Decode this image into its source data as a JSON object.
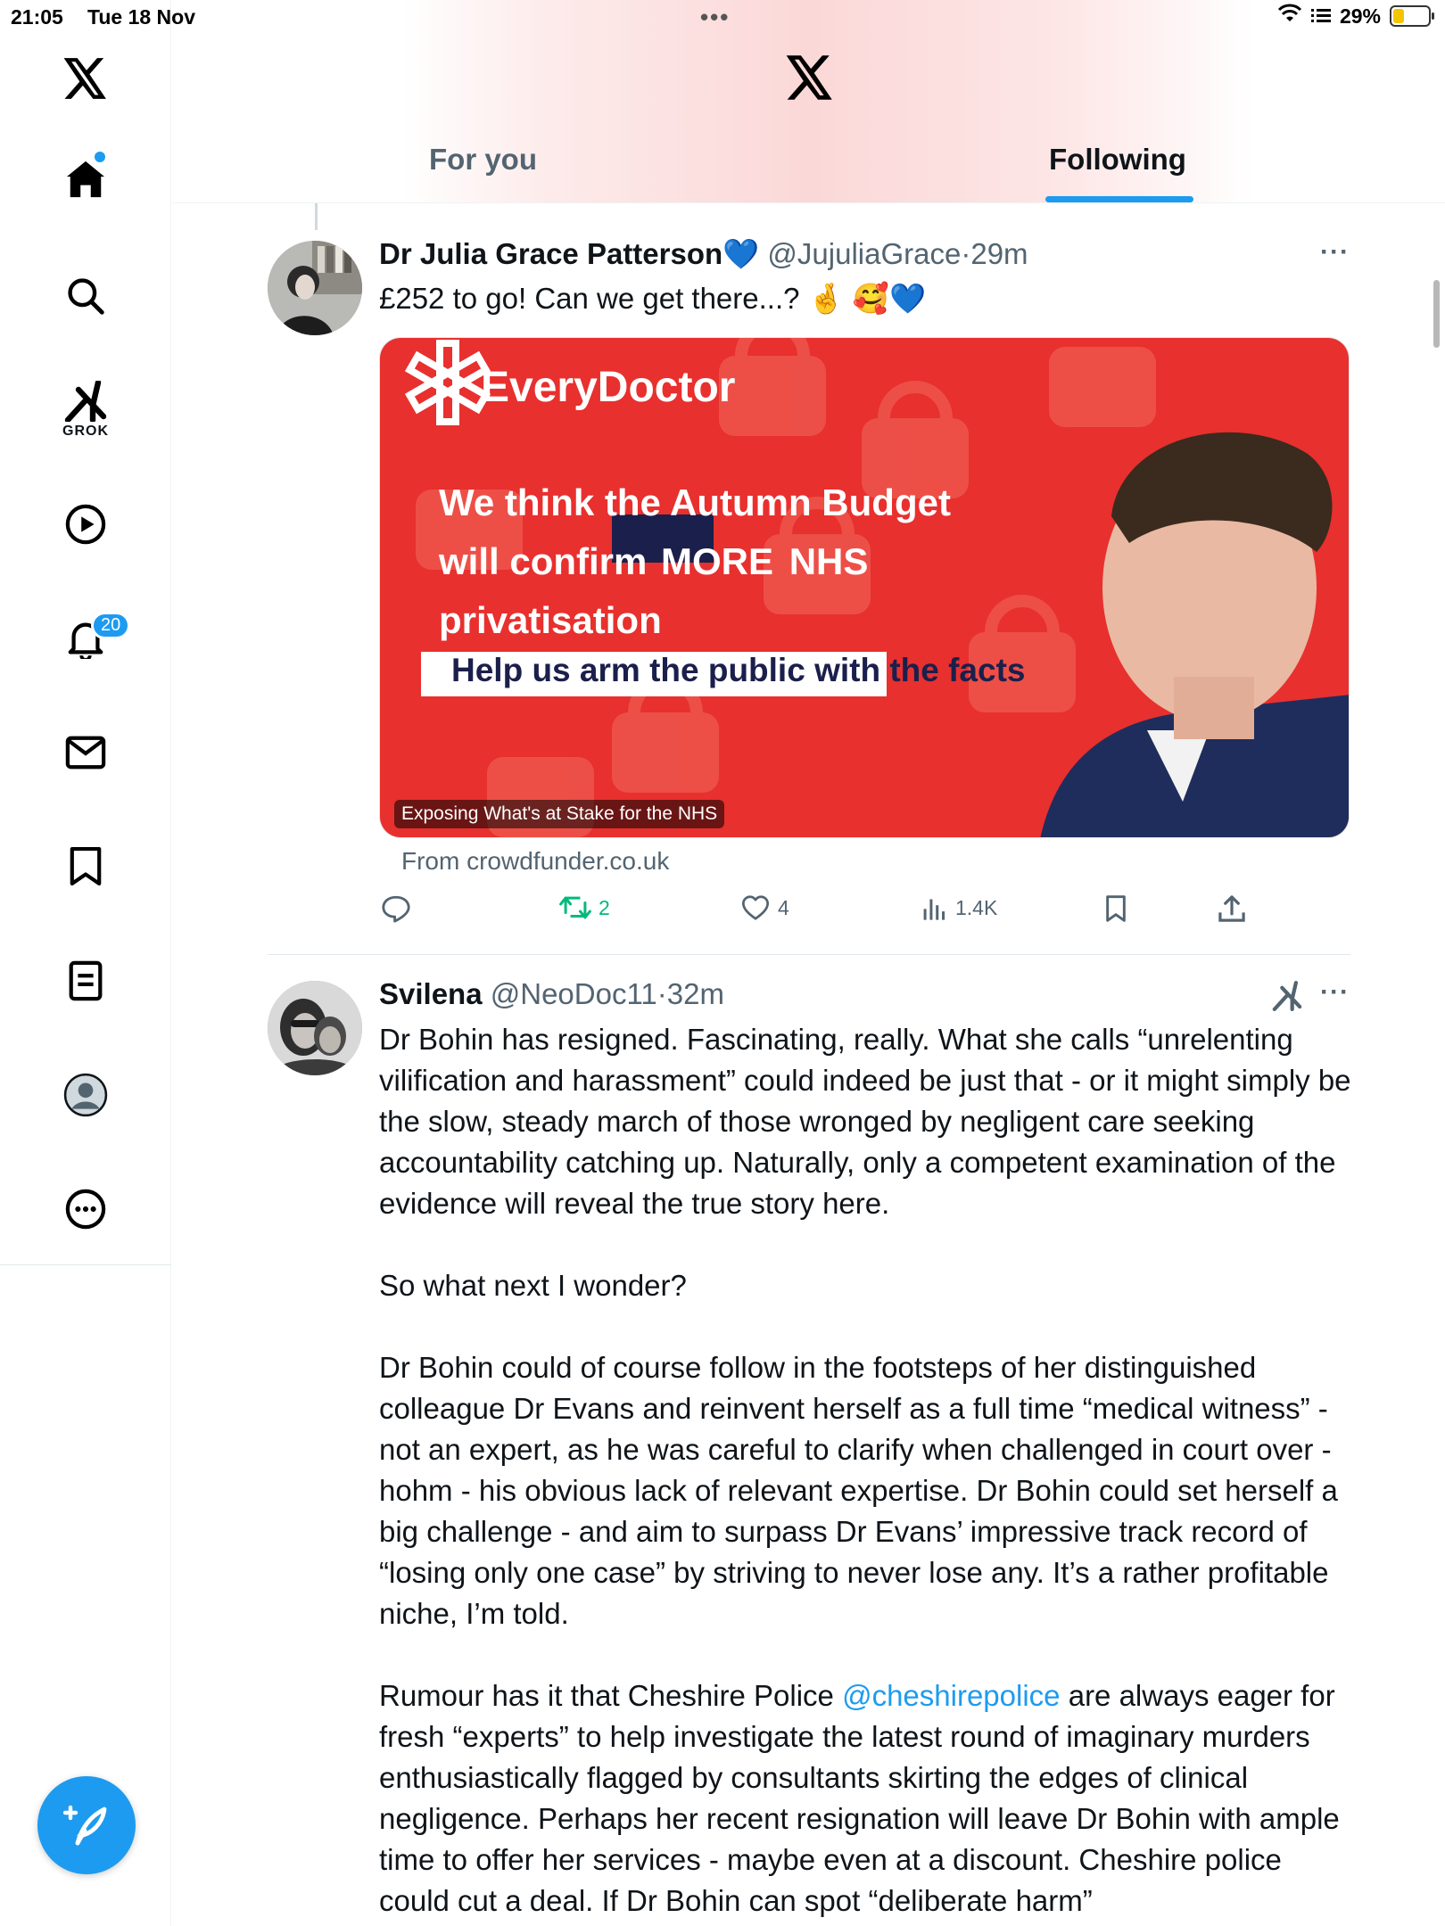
{
  "status_bar": {
    "time": "21:05",
    "date": "Tue 18 Nov",
    "battery_percent": "29%",
    "battery_level": 0.29
  },
  "sidebar": {
    "items": [
      {
        "name": "home",
        "icon": "home-icon"
      },
      {
        "name": "explore",
        "icon": "search-icon"
      },
      {
        "name": "grok",
        "icon": "grok-icon",
        "label": "GROK"
      },
      {
        "name": "video",
        "icon": "play-icon"
      },
      {
        "name": "notifications",
        "icon": "bell-icon",
        "badge": "20"
      },
      {
        "name": "messages",
        "icon": "mail-icon"
      },
      {
        "name": "bookmarks",
        "icon": "bookmark-icon"
      },
      {
        "name": "lists",
        "icon": "list-icon"
      },
      {
        "name": "profile",
        "icon": "avatar-icon"
      },
      {
        "name": "more",
        "icon": "more-icon"
      }
    ],
    "compose_icon": "compose-icon"
  },
  "header": {
    "tabs": [
      {
        "label": "For you",
        "active": false
      },
      {
        "label": "Following",
        "active": true
      }
    ]
  },
  "tweets": [
    {
      "name": "Dr Julia Grace Patterson",
      "name_emoji": "💙",
      "handle": "@JujuliaGrace",
      "separator": "·",
      "time": "29m",
      "text": "£252 to go! Can we get there...? 🤞 🥰💙",
      "card": {
        "brand": "EveryDoctor",
        "headline_1": "We think the Autumn Budget",
        "headline_2a": "will confirm",
        "headline_2b": "MORE",
        "headline_2c": "NHS",
        "headline_3": "privatisation",
        "banner": "Help us arm the public with the facts",
        "caption": "Exposing What's at Stake for the NHS",
        "source": "From crowdfunder.co.uk"
      },
      "actions": {
        "replies": "",
        "reposts": "2",
        "likes": "4",
        "views": "1.4K",
        "retweet_color": "#00ba7c"
      }
    },
    {
      "name": "Svilena",
      "handle": "@NeoDoc11",
      "separator": "·",
      "time": "32m",
      "paragraphs": [
        "Dr Bohin has resigned. Fascinating, really. What she calls “unrelenting vilification and harassment” could indeed be just that - or it might simply be the slow, steady march of those wronged by negligent care seeking accountability catching up. Naturally, only a competent examination of the evidence will reveal the true story here.",
        "So what next I wonder?",
        "Dr Bohin could of course follow in the footsteps of her distinguished colleague Dr Evans and reinvent herself as a full time “medical witness” - not an expert, as he was careful to clarify when challenged in court over - hohm - his obvious lack of relevant expertise. Dr Bohin could set herself a big challenge - and aim to surpass Dr Evans’ impressive track record of “losing only one case” by striving to never lose any. It’s a rather profitable niche, I’m told."
      ],
      "p4_before": "Rumour has it that Cheshire Police ",
      "p4_link": "@cheshirepolice",
      "p4_after": " are always eager for fresh “experts” to help investigate the latest round of imaginary murders enthusiastically flagged by consultants skirting the edges of clinical negligence. Perhaps her recent resignation will leave Dr Bohin with ample time to offer her services - maybe even at a discount. Cheshire police could cut a deal. If Dr Bohin can spot “deliberate harm”"
    }
  ],
  "colors": {
    "accent": "#1d9bf0",
    "card_red": "#e8302e",
    "banner_navy": "#1b1f4b"
  }
}
